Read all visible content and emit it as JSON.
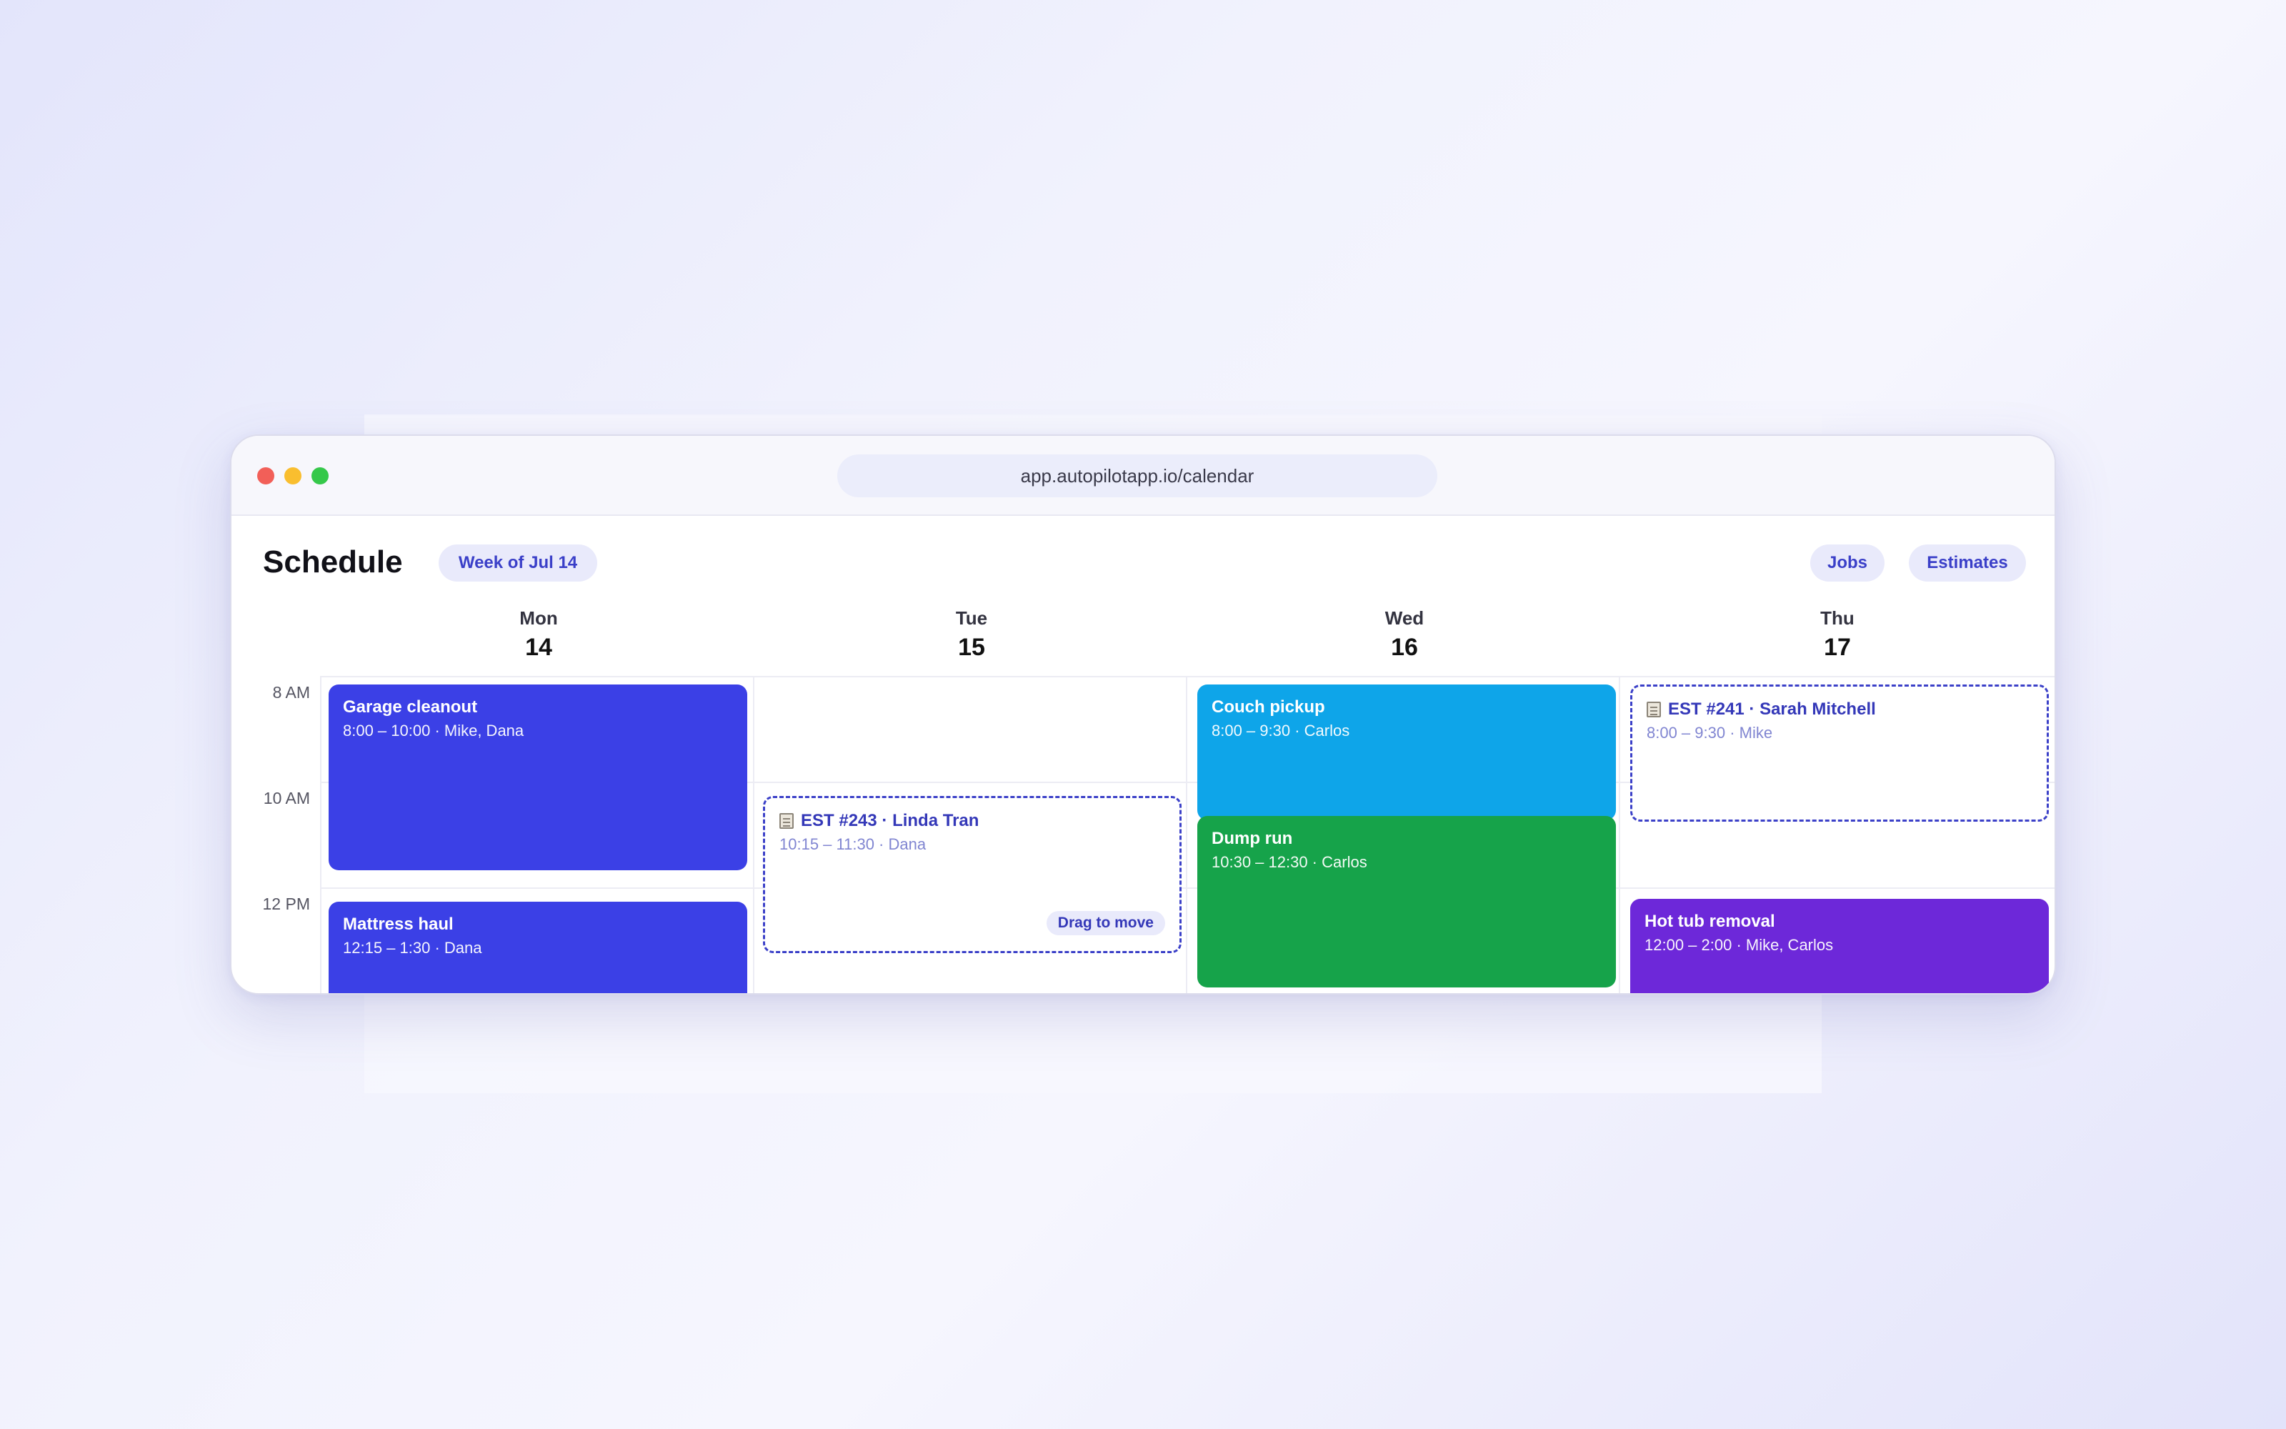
{
  "browser": {
    "url": "app.autopilotapp.io/calendar"
  },
  "header": {
    "title": "Schedule",
    "week_label": "Week of Jul 14",
    "filters": [
      "Jobs",
      "Estimates"
    ]
  },
  "days": [
    {
      "name": "Mon",
      "date": "14"
    },
    {
      "name": "Tue",
      "date": "15"
    },
    {
      "name": "Wed",
      "date": "16"
    },
    {
      "name": "Thu",
      "date": "17"
    }
  ],
  "time_labels": [
    "8 AM",
    "10 AM",
    "12 PM"
  ],
  "events": {
    "garage": {
      "title": "Garage cleanout",
      "time": "8:00 – 10:00 · Mike, Dana",
      "color": "#3b40e6"
    },
    "mattress": {
      "title": "Mattress haul",
      "time": "12:15 – 1:30 · Dana",
      "color": "#3b40e6"
    },
    "est243": {
      "title": "EST #243 · Linda Tran",
      "time": "10:15 – 11:30 · Dana",
      "drag_label": "Drag to move"
    },
    "couch": {
      "title": "Couch pickup",
      "time": "8:00 – 9:30 · Carlos",
      "color": "#0ea5e9"
    },
    "dump": {
      "title": "Dump run",
      "time": "10:30 – 12:30 · Carlos",
      "color": "#16a34a"
    },
    "est241": {
      "title": "EST #241 · Sarah Mitchell",
      "time": "8:00 – 9:30 · Mike"
    },
    "hottub": {
      "title": "Hot tub removal",
      "time": "12:00 – 2:00 · Mike, Carlos",
      "color": "#6d28d9"
    }
  },
  "icons": {
    "estimate_icon": "document-icon"
  }
}
